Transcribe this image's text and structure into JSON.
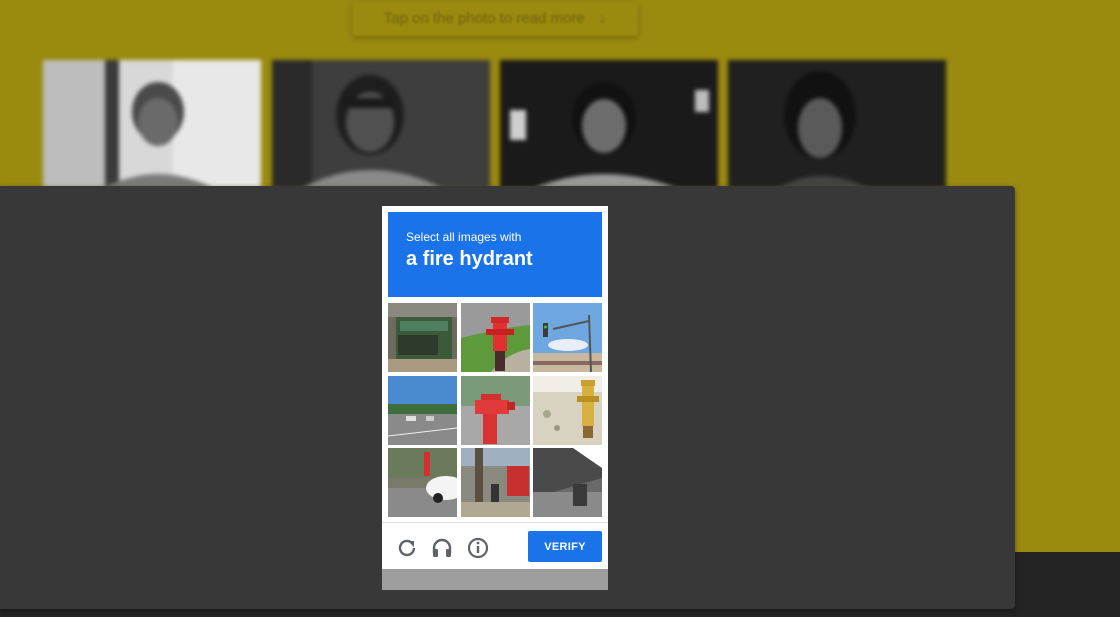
{
  "background": {
    "read_more_label": "Tap on the photo to read more",
    "read_more_icon": "arrow-down-icon"
  },
  "captcha": {
    "instruction": "Select all images with",
    "target": "a fire hydrant",
    "verify_label": "VERIFY",
    "footer_icons": [
      "reload-icon",
      "headphones-icon",
      "info-icon"
    ],
    "accent_color": "#1a73e8"
  }
}
